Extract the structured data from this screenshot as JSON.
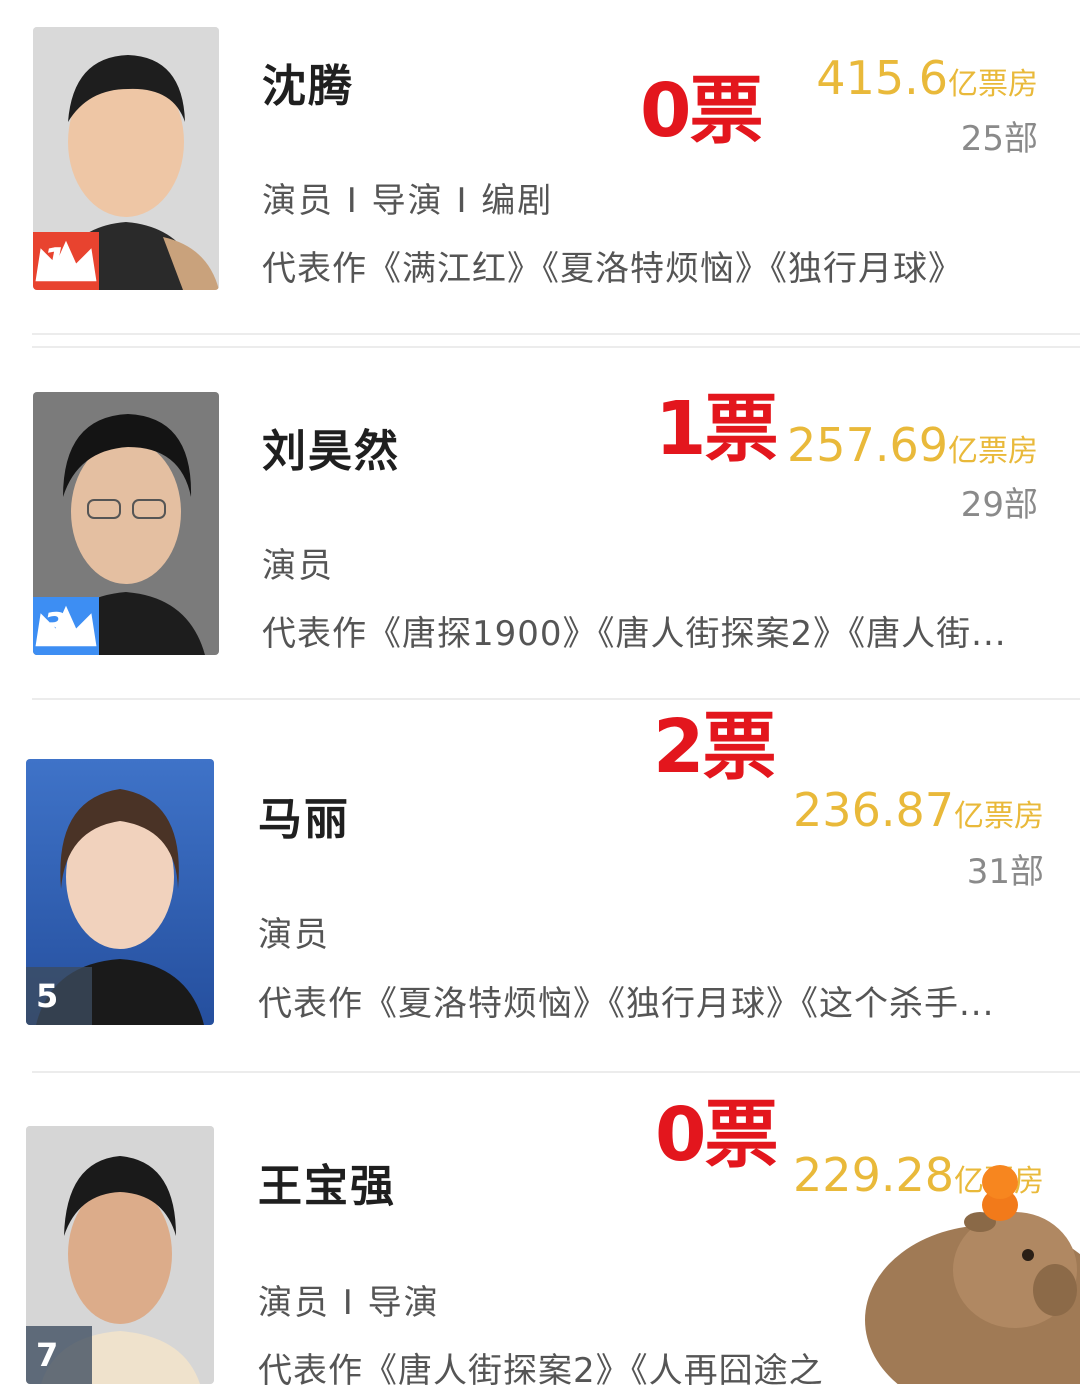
{
  "box_unit": "亿票房",
  "count_unit": "部",
  "people": [
    {
      "name": "沈腾",
      "roles": "演员 I 导演 I 编剧",
      "works": "代表作《满江红》《夏洛特烦恼》《独行月球》",
      "box_office": "415.6",
      "film_count": "25",
      "rank": "1",
      "rank_style": "crown-red",
      "vote": "0票"
    },
    {
      "name": "刘昊然",
      "roles": "演员",
      "works": "代表作《唐探1900》《唐人街探案2》《唐人街...",
      "box_office": "257.69",
      "film_count": "29",
      "rank": "3",
      "rank_style": "crown-blue",
      "vote": "1票"
    },
    {
      "name": "马丽",
      "roles": "演员",
      "works": "代表作《夏洛特烦恼》《独行月球》《这个杀手...",
      "box_office": "236.87",
      "film_count": "31",
      "rank": "5",
      "rank_style": "plain",
      "vote": "2票"
    },
    {
      "name": "王宝强",
      "roles": "演员 I 导演",
      "works": "代表作《唐人街探案2》《人再囧途之",
      "box_office": "229.28",
      "film_count": "",
      "rank": "7",
      "rank_style": "plain",
      "vote": "0票"
    }
  ],
  "colors": {
    "vote": "#e3161d",
    "box_office": "#e9b93a",
    "rank_gold": "#e8432f",
    "rank_blue": "#3d8ef3"
  },
  "icons": [
    "crown-icon",
    "capybara-sticker"
  ]
}
